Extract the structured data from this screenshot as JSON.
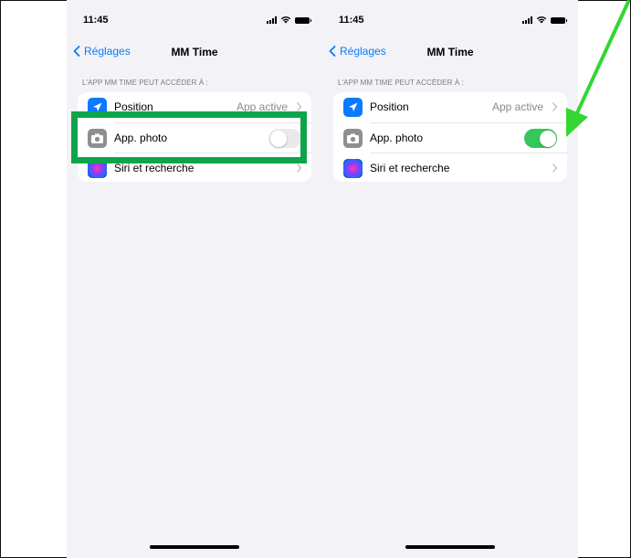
{
  "screens": [
    {
      "id": "left",
      "status_time": "11:45",
      "back_label": "Réglages",
      "title": "MM Time",
      "section_header": "L'APP MM TIME PEUT ACCÉDER À :",
      "rows": [
        {
          "label": "Position",
          "value": "App active",
          "icon": "location-arrow-icon"
        },
        {
          "label": "App. photo",
          "toggle": "off",
          "icon": "camera-icon"
        },
        {
          "label": "Siri et recherche",
          "icon": "siri-icon"
        }
      ]
    },
    {
      "id": "right",
      "status_time": "11:45",
      "back_label": "Réglages",
      "title": "MM Time",
      "section_header": "L'APP MM TIME PEUT ACCÉDER À :",
      "rows": [
        {
          "label": "Position",
          "value": "App active",
          "icon": "location-arrow-icon"
        },
        {
          "label": "App. photo",
          "toggle": "on",
          "icon": "camera-icon"
        },
        {
          "label": "Siri et recherche",
          "icon": "siri-icon"
        }
      ]
    }
  ],
  "colors": {
    "accent": "#0a7aff",
    "toggle_on": "#34c759",
    "highlight": "#0ea54a",
    "arrow": "#34d634"
  }
}
